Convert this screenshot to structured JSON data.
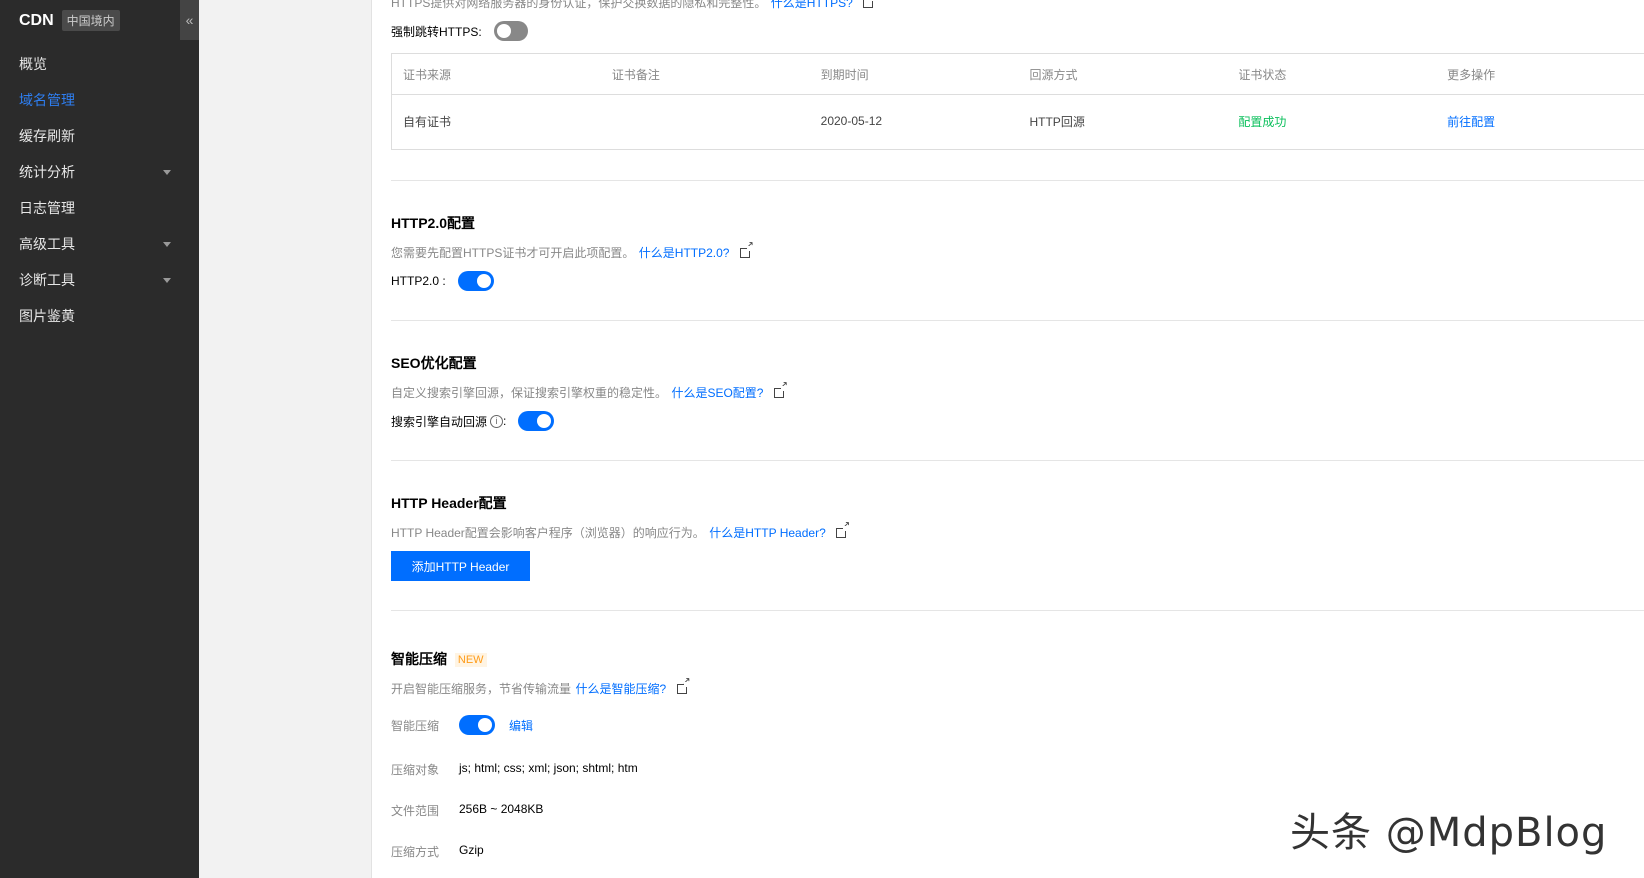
{
  "sidebar": {
    "brand": "CDN",
    "region_badge": "中国境内",
    "collapse_icon": "«",
    "items": [
      {
        "label": "概览",
        "active": false,
        "has_caret": false
      },
      {
        "label": "域名管理",
        "active": true,
        "has_caret": false
      },
      {
        "label": "缓存刷新",
        "active": false,
        "has_caret": false
      },
      {
        "label": "统计分析",
        "active": false,
        "has_caret": true
      },
      {
        "label": "日志管理",
        "active": false,
        "has_caret": false
      },
      {
        "label": "高级工具",
        "active": false,
        "has_caret": true
      },
      {
        "label": "诊断工具",
        "active": false,
        "has_caret": true
      },
      {
        "label": "图片鉴黄",
        "active": false,
        "has_caret": false
      }
    ]
  },
  "https": {
    "desc": "HTTPS提供对网络服务器的身份认证，保护交换数据的隐私和完整性。",
    "link": "什么是HTTPS?",
    "force_label": "强制跳转HTTPS:",
    "force_enabled": false,
    "table": {
      "headers": [
        "证书来源",
        "证书备注",
        "到期时间",
        "回源方式",
        "证书状态",
        "更多操作"
      ],
      "row": {
        "source": "自有证书",
        "note": "",
        "expires": "2020-05-12",
        "origin": "HTTP回源",
        "status": "配置成功",
        "action": "前往配置"
      }
    }
  },
  "http2": {
    "title": "HTTP2.0配置",
    "desc": "您需要先配置HTTPS证书才可开启此项配置。",
    "link": "什么是HTTP2.0?",
    "label": "HTTP2.0 :",
    "enabled": true
  },
  "seo": {
    "title": "SEO优化配置",
    "desc": "自定义搜索引擎回源，保证搜索引擎权重的稳定性。",
    "link": "什么是SEO配置?",
    "label": "搜索引擎自动回源",
    "label_suffix": ":",
    "info_icon": "i",
    "enabled": true
  },
  "header": {
    "title": "HTTP Header配置",
    "desc": "HTTP Header配置会影响客户程序（浏览器）的响应行为。",
    "link": "什么是HTTP Header?",
    "button": "添加HTTP Header"
  },
  "compress": {
    "title": "智能压缩",
    "badge": "NEW",
    "desc": "开启智能压缩服务，节省传输流量",
    "link": "什么是智能压缩?",
    "label": "智能压缩",
    "enabled": true,
    "edit": "编辑",
    "rows": [
      {
        "key": "压缩对象",
        "value": "js; html; css; xml; json; shtml; htm"
      },
      {
        "key": "文件范围",
        "value": "256B ~ 2048KB"
      },
      {
        "key": "压缩方式",
        "value": "Gzip"
      }
    ]
  },
  "watermark": "头条 @MdpBlog",
  "colors": {
    "accent": "#006eff",
    "sidebar_bg": "#2b2b2b",
    "success": "#0abf5b",
    "badge_orange": "#ff9c19"
  }
}
